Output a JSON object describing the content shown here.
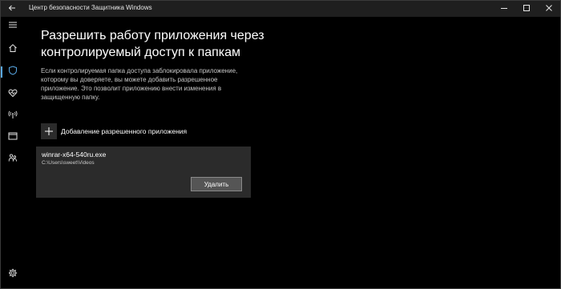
{
  "window": {
    "title": "Центр безопасности Защитника Windows"
  },
  "icons": {
    "back": "back-arrow-icon",
    "minimize": "minimize-icon",
    "maximize": "maximize-icon",
    "close": "close-icon",
    "menu": "hamburger-menu-icon",
    "home": "home-icon",
    "virus_protection": "shield-icon",
    "health": "heart-icon",
    "firewall": "wireless-antenna-icon",
    "app_browser": "browser-window-icon",
    "family": "family-icon",
    "settings": "gear-icon",
    "add": "plus-icon"
  },
  "colors": {
    "accent": "#5aa9e6",
    "background": "#000000",
    "card": "#2b2b2b"
  },
  "main": {
    "title": "Разрешить работу приложения через контролируемый доступ к папкам",
    "description": "Если контролируемая папка доступа заблокировала приложение, которому вы доверяете, вы можете добавить разрешенное приложение. Это позволит приложению внести изменения в защищенную папку.",
    "add_app_label": "Добавление разрешенного приложения",
    "app": {
      "name": "winrar-x64-540ru.exe",
      "path": "C:\\Users\\sweet\\Videos",
      "remove_label": "Удалить"
    }
  }
}
